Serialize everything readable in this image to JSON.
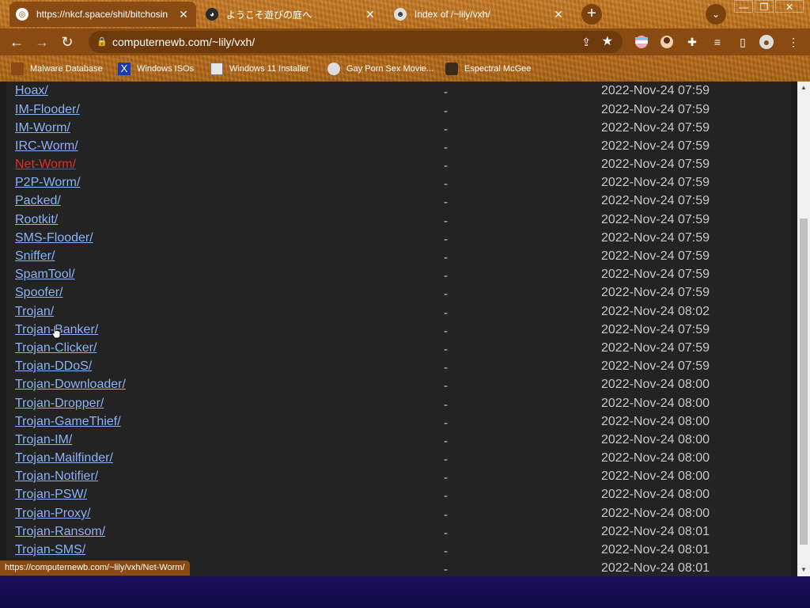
{
  "tabs": [
    {
      "title": "https://nkcf.space/shit/bitchosin",
      "active": true
    },
    {
      "title": "ようこそ遊びの庭へ",
      "active": false
    },
    {
      "title": "Index of /~lily/vxh/",
      "active": false
    }
  ],
  "toolbar": {
    "url": "computernewb.com/~lily/vxh/"
  },
  "bookmarks": [
    {
      "label": "Malware Database"
    },
    {
      "label": "Windows ISOs"
    },
    {
      "label": "Windows 11 Installer"
    },
    {
      "label": "Gay Porn Sex Movie..."
    },
    {
      "label": "Espectral McGee"
    }
  ],
  "listing": [
    {
      "name": "Hoax/",
      "size": "-",
      "date": "2022-Nov-24 07:59"
    },
    {
      "name": "IM-Flooder/",
      "size": "-",
      "date": "2022-Nov-24 07:59"
    },
    {
      "name": "IM-Worm/",
      "size": "-",
      "date": "2022-Nov-24 07:59"
    },
    {
      "name": "IRC-Worm/",
      "size": "-",
      "date": "2022-Nov-24 07:59"
    },
    {
      "name": "Net-Worm/",
      "size": "-",
      "date": "2022-Nov-24 07:59"
    },
    {
      "name": "P2P-Worm/",
      "size": "-",
      "date": "2022-Nov-24 07:59"
    },
    {
      "name": "Packed/",
      "size": "-",
      "date": "2022-Nov-24 07:59"
    },
    {
      "name": "Rootkit/",
      "size": "-",
      "date": "2022-Nov-24 07:59"
    },
    {
      "name": "SMS-Flooder/",
      "size": "-",
      "date": "2022-Nov-24 07:59"
    },
    {
      "name": "Sniffer/",
      "size": "-",
      "date": "2022-Nov-24 07:59"
    },
    {
      "name": "SpamTool/",
      "size": "-",
      "date": "2022-Nov-24 07:59"
    },
    {
      "name": "Spoofer/",
      "size": "-",
      "date": "2022-Nov-24 07:59"
    },
    {
      "name": "Trojan/",
      "size": "-",
      "date": "2022-Nov-24 08:02"
    },
    {
      "name": "Trojan-Banker/",
      "size": "-",
      "date": "2022-Nov-24 07:59"
    },
    {
      "name": "Trojan-Clicker/",
      "size": "-",
      "date": "2022-Nov-24 07:59"
    },
    {
      "name": "Trojan-DDoS/",
      "size": "-",
      "date": "2022-Nov-24 07:59"
    },
    {
      "name": "Trojan-Downloader/",
      "size": "-",
      "date": "2022-Nov-24 08:00"
    },
    {
      "name": "Trojan-Dropper/",
      "size": "-",
      "date": "2022-Nov-24 08:00"
    },
    {
      "name": "Trojan-GameThief/",
      "size": "-",
      "date": "2022-Nov-24 08:00"
    },
    {
      "name": "Trojan-IM/",
      "size": "-",
      "date": "2022-Nov-24 08:00"
    },
    {
      "name": "Trojan-Mailfinder/",
      "size": "-",
      "date": "2022-Nov-24 08:00"
    },
    {
      "name": "Trojan-Notifier/",
      "size": "-",
      "date": "2022-Nov-24 08:00"
    },
    {
      "name": "Trojan-PSW/",
      "size": "-",
      "date": "2022-Nov-24 08:00"
    },
    {
      "name": "Trojan-Proxy/",
      "size": "-",
      "date": "2022-Nov-24 08:00"
    },
    {
      "name": "Trojan-Ransom/",
      "size": "-",
      "date": "2022-Nov-24 08:01"
    },
    {
      "name": "Trojan-SMS/",
      "size": "-",
      "date": "2022-Nov-24 08:01"
    },
    {
      "name": "",
      "size": "-",
      "date": "2022-Nov-24 08:01"
    }
  ],
  "status": {
    "url": "https://computernewb.com/~lily/vxh/Net-Worm/"
  },
  "colors": {
    "link": "#8ab4f8",
    "link_hover": "#e52b2b",
    "page_bg": "#232323",
    "chrome_accent": "#8a4b12"
  }
}
